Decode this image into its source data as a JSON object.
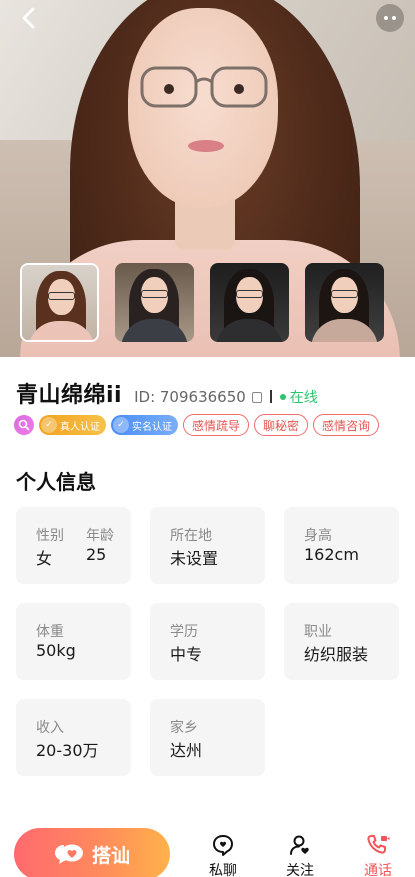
{
  "header": {
    "back_icon": "chevron-left-icon",
    "more_icon": "more-dots-icon"
  },
  "gallery": {
    "thumbnail_count": 4,
    "active_index": 0
  },
  "profile": {
    "name": "青山绵绵ii",
    "id_text": "ID: 709636650",
    "status": "在线",
    "status_color": "#2fc26b",
    "badges": [
      {
        "label": "真人认证",
        "color": "#f1a21d"
      },
      {
        "label": "实名认证",
        "color": "#4b8df5"
      }
    ],
    "tags": [
      "感情疏导",
      "聊秘密",
      "感情咨询"
    ]
  },
  "info": {
    "title": "个人信息",
    "gender_label": "性别",
    "gender_value": "女",
    "age_label": "年龄",
    "age_value": "25",
    "location_label": "所在地",
    "location_value": "未设置",
    "height_label": "身高",
    "height_value": "162cm",
    "weight_label": "体重",
    "weight_value": "50kg",
    "education_label": "学历",
    "education_value": "中专",
    "job_label": "职业",
    "job_value": "纺织服装",
    "income_label": "收入",
    "income_value": "20-30万",
    "hometown_label": "家乡",
    "hometown_value": "达州"
  },
  "bottom_bar": {
    "chat_button": "搭讪",
    "private_chat": "私聊",
    "follow": "关注",
    "call": "通话",
    "accent_color": "#f2545b"
  }
}
